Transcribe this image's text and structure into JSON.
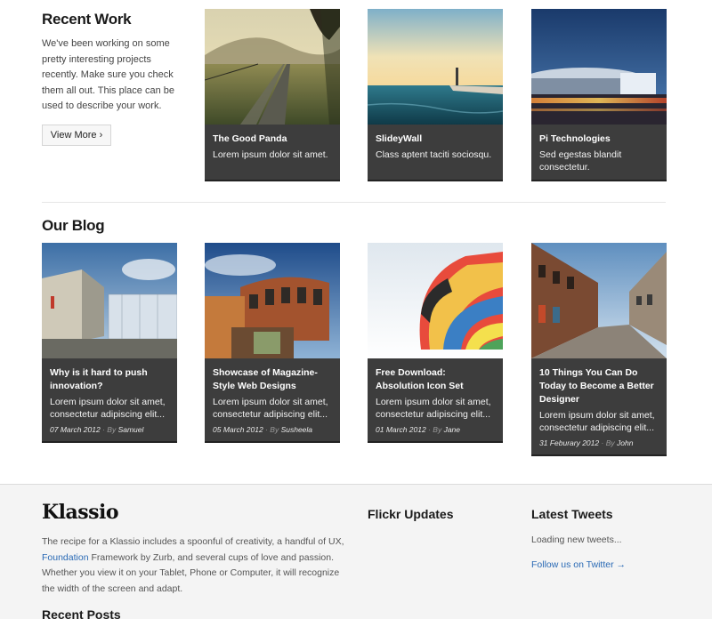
{
  "recent_work": {
    "title": "Recent Work",
    "intro": "We've been working on some pretty interesting projects recently. Make sure you check them all out. This place can be used to describe your work.",
    "button_label": "View More ›",
    "items": [
      {
        "title": "The Good Panda",
        "desc": "Lorem ipsum dolor sit amet."
      },
      {
        "title": "SlideyWall",
        "desc": "Class aptent taciti sociosqu."
      },
      {
        "title": "Pi Technologies",
        "desc": "Sed egestas blandit consectetur."
      }
    ]
  },
  "blog": {
    "title": "Our Blog",
    "posts": [
      {
        "title": "Why is it hard to push innovation?",
        "desc": "Lorem ipsum dolor sit amet, consectetur adipiscing elit...",
        "date": "07 March 2012",
        "by": "By",
        "author": "Samuel"
      },
      {
        "title": "Showcase of Magazine-Style Web Designs",
        "desc": "Lorem ipsum dolor sit amet, consectetur adipiscing elit...",
        "date": "05 March 2012",
        "by": "By",
        "author": "Susheela"
      },
      {
        "title": "Free Download: Absolution Icon Set",
        "desc": "Lorem ipsum dolor sit amet, consectetur adipiscing elit...",
        "date": "01 March 2012",
        "by": "By",
        "author": "Jane"
      },
      {
        "title": "10 Things You Can Do Today to Become a Better Designer",
        "desc": "Lorem ipsum dolor sit amet, consectetur adipiscing elit...",
        "date": "31 Feburary 2012",
        "by": "By",
        "author": "John"
      }
    ]
  },
  "footer": {
    "brand": "Klassio",
    "text_before_link": "The recipe for a Klassio includes a spoonful of creativity, a handful of UX, ",
    "link": "Foundation",
    "text_after_link": " Framework by Zurb, and several cups of love and passion. Whether you view it on your Tablet, Phone or Computer, it will recognize the width of the screen and adapt.",
    "flickr_title": "Flickr Updates",
    "tweets_title": "Latest Tweets",
    "tweets_loading": "Loading new tweets...",
    "follow_label": "Follow us on Twitter →",
    "recent_posts_title": "Recent Posts"
  },
  "colors": {
    "card_bg": "#3d3d3d",
    "link": "#2a6ab5",
    "footer_bg": "#f4f4f4"
  },
  "icons": {
    "thumbnails": [
      "road-landscape-image",
      "lighthouse-sea-image",
      "stadium-night-image",
      "modern-building-image",
      "brick-building-image",
      "parachute-image",
      "old-street-image"
    ]
  }
}
